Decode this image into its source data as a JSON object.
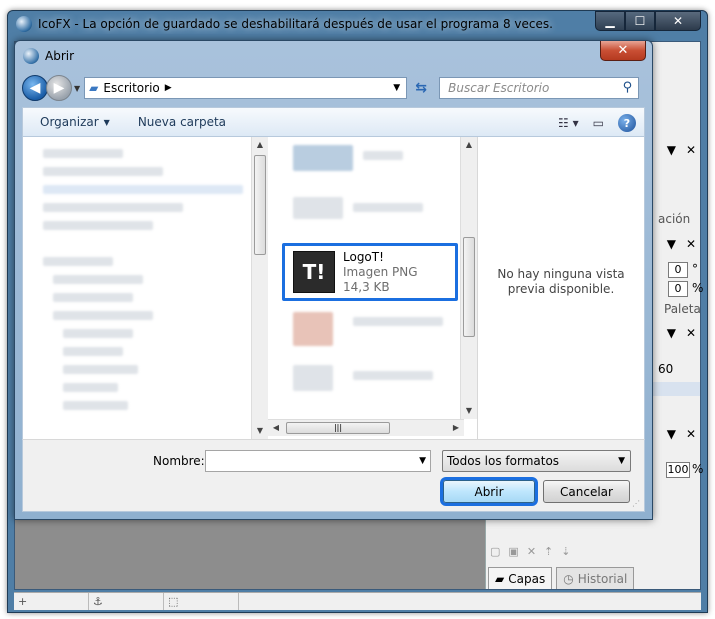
{
  "app": {
    "title": "IcoFX - La opción de guardado se deshabilitará después de usar el programa 8 veces.",
    "window_controls": {
      "minimize": "▁",
      "maximize": "☐",
      "close": "✕"
    },
    "right_panel": {
      "section1_suffix": "ación",
      "field1_value": "0",
      "field1_unit": "°",
      "field2_value": "0",
      "field2_unit": "%",
      "section2_label": "Paleta",
      "field3_value": "60",
      "zoom_value": "100",
      "zoom_unit": "%",
      "close_glyph": "✕",
      "menu_glyph": "▼"
    },
    "tabs": [
      {
        "label": "Capas",
        "icon": "layers-icon"
      },
      {
        "label": "Historial",
        "icon": "history-icon"
      }
    ],
    "status": {
      "cell1": "+",
      "cell2": "⚓",
      "cell3": "⬚"
    }
  },
  "dialog": {
    "title": "Abrir",
    "close_glyph": "✕",
    "address": {
      "location": "Escritorio"
    },
    "search": {
      "placeholder": "Buscar Escritorio"
    },
    "commands": {
      "organize": "Organizar",
      "new_folder": "Nueva carpeta"
    },
    "file": {
      "name": "LogoT!",
      "type": "Imagen PNG",
      "size": "14,3 KB",
      "thumb_text": "T!"
    },
    "preview_text": "No hay ninguna vista previa disponible.",
    "name_label": "Nombre:",
    "name_value": "",
    "filter_value": "Todos los formatos",
    "open_button": "Abrir",
    "cancel_button": "Cancelar"
  },
  "colors": {
    "highlight": "#1b6fe0",
    "title_bar": "#4f7ea6",
    "close_red": "#c94f34"
  }
}
